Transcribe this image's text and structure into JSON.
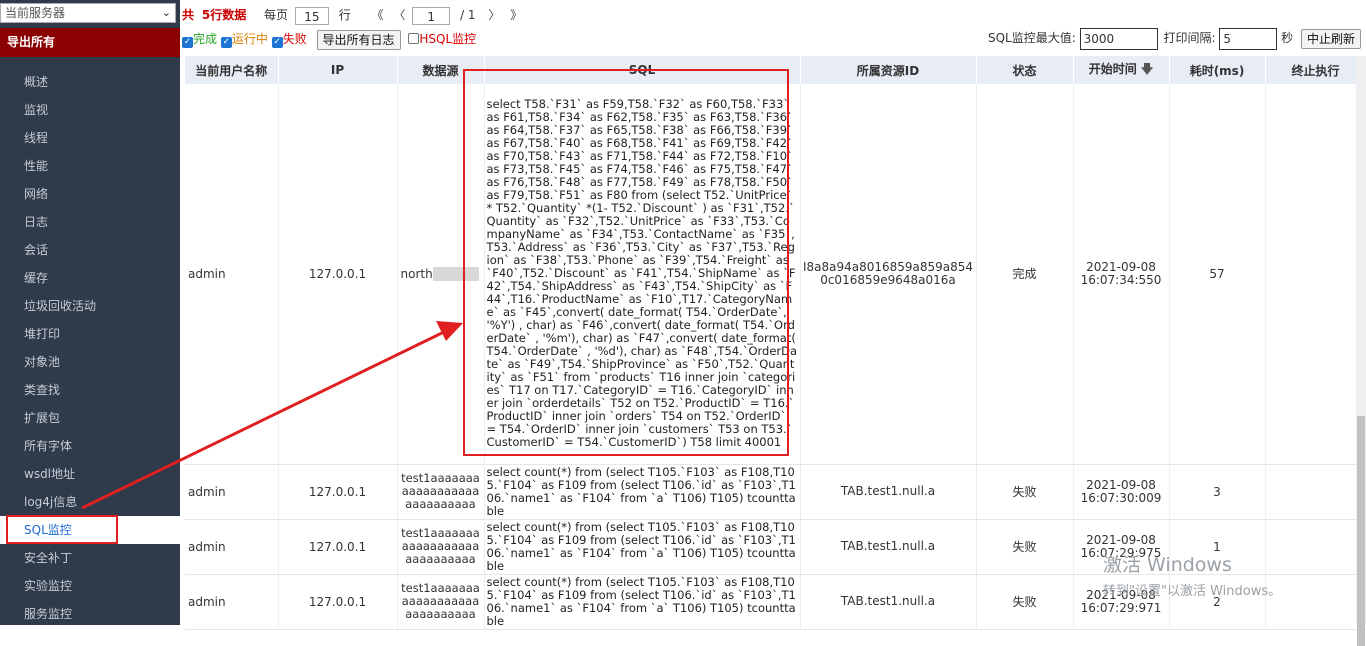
{
  "sidebar": {
    "server_select": "当前服务器",
    "export_all": "导出所有",
    "items": [
      {
        "label": "概述"
      },
      {
        "label": "监视"
      },
      {
        "label": "线程"
      },
      {
        "label": "性能"
      },
      {
        "label": "网络"
      },
      {
        "label": "日志"
      },
      {
        "label": "会话"
      },
      {
        "label": "缓存"
      },
      {
        "label": "垃圾回收活动"
      },
      {
        "label": "堆打印"
      },
      {
        "label": "对象池"
      },
      {
        "label": "类查找"
      },
      {
        "label": "扩展包"
      },
      {
        "label": "所有字体"
      },
      {
        "label": "wsdl地址"
      },
      {
        "label": "log4j信息"
      },
      {
        "label": "SQL监控"
      },
      {
        "label": "安全补丁"
      },
      {
        "label": "实验监控"
      },
      {
        "label": "服务监控"
      }
    ],
    "active_index": 16
  },
  "toolbar": {
    "total_prefix": "共",
    "total_rows": "5行数据",
    "per_page_label": "每页",
    "per_page_value": "15",
    "rows_unit": "行",
    "first_btn": "《",
    "prev_btn": "〈",
    "page_value": "1",
    "page_total": "/ 1",
    "next_btn": "〉",
    "last_btn": "》",
    "filter_done": "完成",
    "filter_running": "运行中",
    "filter_failed": "失败",
    "export_log_btn": "导出所有日志",
    "hsql_monitor": "HSQL监控",
    "sql_max_label": "SQL监控最大值:",
    "sql_max_value": "3000",
    "print_interval_label": "打印间隔:",
    "print_interval_value": "5",
    "seconds_unit": "秒",
    "stop_refresh_btn": "中止刷新"
  },
  "table": {
    "headers": {
      "user": "当前用户名称",
      "ip": "IP",
      "datasource": "数据源",
      "sql": "SQL",
      "resource": "所属资源ID",
      "status": "状态",
      "start_time": "开始时间",
      "duration": "耗时(ms)",
      "terminate": "终止执行"
    },
    "sort_icon": "arrow-down-icon",
    "rows": [
      {
        "user": "admin",
        "ip": "127.0.0.1",
        "datasource": "north",
        "sql": "select T58.`F31` as F59,T58.`F32` as F60,T58.`F33` as F61,T58.`F34` as F62,T58.`F35` as F63,T58.`F36` as F64,T58.`F37` as F65,T58.`F38` as F66,T58.`F39` as F67,T58.`F40` as F68,T58.`F41` as F69,T58.`F42` as F70,T58.`F43` as F71,T58.`F44` as F72,T58.`F10` as F73,T58.`F45` as F74,T58.`F46` as F75,T58.`F47` as F76,T58.`F48` as F77,T58.`F49` as F78,T58.`F50` as F79,T58.`F51` as F80 from (select T52.`UnitPrice` * T52.`Quantity` *(1- T52.`Discount` ) as `F31`,T52.`Quantity` as `F32`,T52.`UnitPrice` as `F33`,T53.`CompanyName` as `F34`,T53.`ContactName` as `F35`,T53.`Address` as `F36`,T53.`City` as `F37`,T53.`Region` as `F38`,T53.`Phone` as `F39`,T54.`Freight` as `F40`,T52.`Discount` as `F41`,T54.`ShipName` as `F42`,T54.`ShipAddress` as `F43`,T54.`ShipCity` as `F44`,T16.`ProductName` as `F10`,T17.`CategoryName` as `F45`,convert( date_format( T54.`OrderDate`, '%Y') , char) as `F46`,convert( date_format( T54.`OrderDate` , '%m'), char) as `F47`,convert( date_format( T54.`OrderDate` , '%d'), char) as `F48`,T54.`OrderDate` as `F49`,T54.`ShipProvince` as `F50`,T52.`Quantity` as `F51` from `products` T16 inner join `categories` T17 on T17.`CategoryID` = T16.`CategoryID` inner join `orderdetails` T52 on T52.`ProductID` = T16.`ProductID` inner join `orders` T54 on T52.`OrderID` = T54.`OrderID` inner join `customers` T53 on T53.`CustomerID` = T54.`CustomerID`) T58 limit 40001",
        "resource": "I8a8a94a8016859a859a8540c016859e9648a016a",
        "status": "完成",
        "status_kind": "done",
        "start_date": "2021-09-08",
        "start_clock": "16:07:34:550",
        "duration": "57"
      },
      {
        "user": "admin",
        "ip": "127.0.0.1",
        "datasource": "test1aaaaaaaaaaaaaaaaaaaaaaaaaaaa",
        "sql": "select count(*) from (select T105.`F103` as F108,T105.`F104` as F109 from (select T106.`id` as `F103`,T106.`name1` as `F104` from `a` T106) T105) tcounttable",
        "resource": "TAB.test1.null.a",
        "status": "失败",
        "status_kind": "fail",
        "start_date": "2021-09-08",
        "start_clock": "16:07:30:009",
        "duration": "3"
      },
      {
        "user": "admin",
        "ip": "127.0.0.1",
        "datasource": "test1aaaaaaaaaaaaaaaaaaaaaaaaaaaa",
        "sql": "select count(*) from (select T105.`F103` as F108,T105.`F104` as F109 from (select T106.`id` as `F103`,T106.`name1` as `F104` from `a` T106) T105) tcounttable",
        "resource": "TAB.test1.null.a",
        "status": "失败",
        "status_kind": "fail",
        "start_date": "2021-09-08",
        "start_clock": "16:07:29:975",
        "duration": "1"
      },
      {
        "user": "admin",
        "ip": "127.0.0.1",
        "datasource": "test1aaaaaaaaaaaaaaaaaaaaaaaaaaaa",
        "sql": "select count(*) from (select T105.`F103` as F108,T105.`F104` as F109 from (select T106.`id` as `F103`,T106.`name1` as `F104` from `a` T106) T105) tcounttable",
        "resource": "TAB.test1.null.a",
        "status": "失败",
        "status_kind": "fail",
        "start_date": "2021-09-08",
        "start_clock": "16:07:29:971",
        "duration": "2"
      }
    ]
  },
  "watermark": {
    "line1": "激活 Windows",
    "line2": "转到\"设置\"以激活 Windows。"
  },
  "colors": {
    "sidebar_bg": "#2f3a4a",
    "export_bg": "#8b0000",
    "highlight": "#e02020",
    "done": "#1f8f1f",
    "fail": "#e00000",
    "header_bg": "#e8ecf5"
  }
}
